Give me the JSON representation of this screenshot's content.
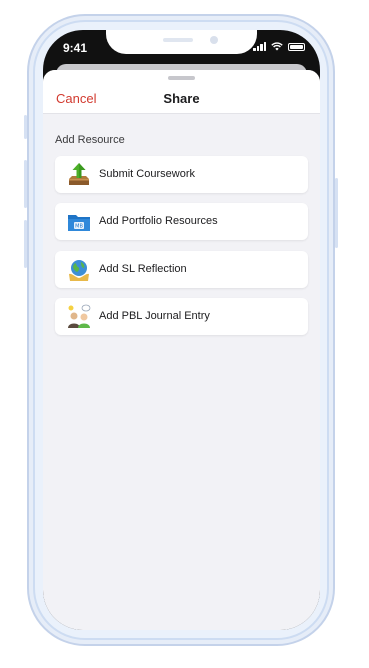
{
  "status_bar": {
    "time": "9:41"
  },
  "sheet": {
    "cancel_label": "Cancel",
    "title": "Share",
    "section_label": "Add Resource",
    "items": [
      {
        "label": "Submit Coursework",
        "icon": "upload-arrow-icon"
      },
      {
        "label": "Add Portfolio Resources",
        "icon": "portfolio-folder-icon"
      },
      {
        "label": "Add SL Reflection",
        "icon": "globe-hands-icon"
      },
      {
        "label": "Add PBL Journal Entry",
        "icon": "people-discussion-icon"
      }
    ]
  },
  "colors": {
    "accent_cancel": "#d23a2f",
    "background": "#f2f2f6",
    "frame": "#e6edf8"
  }
}
